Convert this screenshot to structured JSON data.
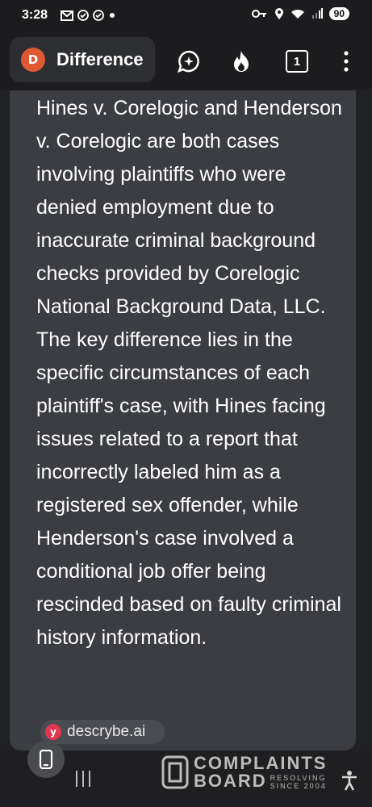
{
  "status_bar": {
    "time": "3:28",
    "battery": "90",
    "left_icons": [
      "gmail-icon",
      "check-circle-icon",
      "check-circle-icon",
      "dot-icon"
    ],
    "right_icons": [
      "key-icon",
      "location-icon",
      "wifi-icon",
      "signal-icon"
    ]
  },
  "toolbar": {
    "url_text": "Difference",
    "tab_count": "1",
    "buttons": [
      "chat-icon",
      "fire-icon",
      "tab-switcher",
      "more-icon"
    ]
  },
  "answer": {
    "text": "Hines v. Corelogic and Henderson v. Corelogic are both cases involving plaintiffs who were denied employment due to inaccurate criminal background checks provided by Corelogic National Background Data, LLC. The key difference lies in the specific circumstances of each plaintiff's case, with Hines facing issues related to a report that incorrectly labeled him as a registered sex offender, while Henderson's case involved a conditional job offer being rescinded based on faulty criminal history information."
  },
  "source": {
    "label": "descrybe.ai"
  },
  "watermark": {
    "line1": "COMPLAINTS",
    "line2": "BOARD",
    "tag1": "RESOLVING",
    "tag2": "SINCE 2004"
  },
  "colors": {
    "background": "#202124",
    "card": "#3b3d42",
    "ddg_orange": "#de5833",
    "source_red": "#e0374f"
  }
}
